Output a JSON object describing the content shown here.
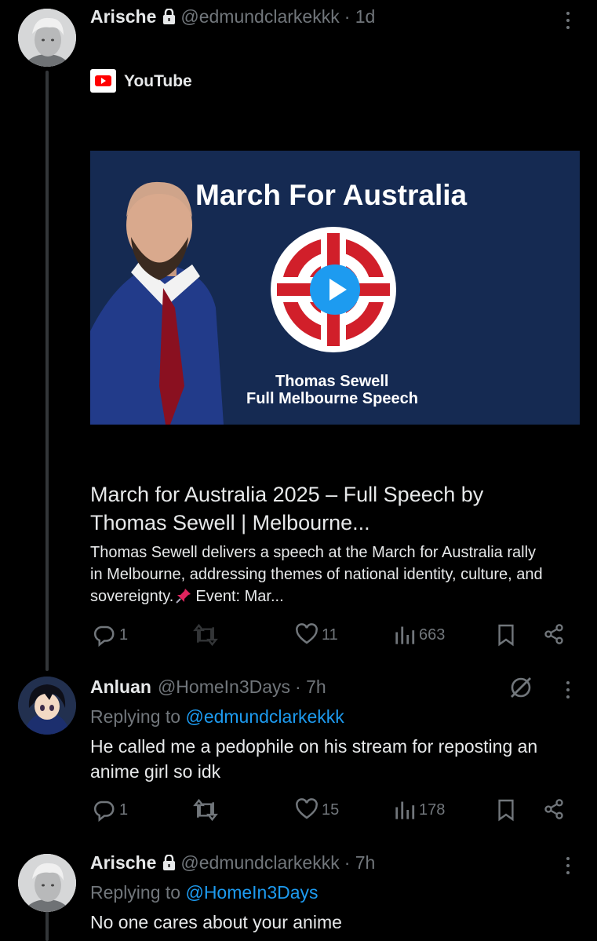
{
  "posts": [
    {
      "author": "Arische",
      "handle": "@edmundclarkekkk",
      "time": "· 1d",
      "link_card": {
        "site": "YouTube",
        "thumbnail": {
          "headline": "March For Australia",
          "caption_line1": "Thomas Sewell",
          "caption_line2": "Full Melbourne Speech"
        },
        "title_line1": "March for Australia 2025 – Full Speech by",
        "title_line2": "Thomas Sewell | Melbourne...",
        "description_line1": "Thomas Sewell delivers a speech at the March for Australia rally",
        "description_line2": "in Melbourne, addressing themes of national identity, culture, and",
        "description_line3": "sovereignty.",
        "description_line3b": "Event: Mar...",
        "pin_icon": "pushpin-icon"
      },
      "stats": {
        "replies": "1",
        "retweets": "",
        "likes": "11",
        "views": "663"
      }
    },
    {
      "author": "Anluan",
      "handle": "@HomeIn3Days",
      "time": "· 7h",
      "replying_label": "Replying to",
      "replying_to": "@edmundclarkekkk",
      "text_line1": "He called me a pedophile on his stream for reposting an",
      "text_line2": "anime girl so idk",
      "stats": {
        "replies": "1",
        "retweets": "",
        "likes": "15",
        "views": "178"
      }
    },
    {
      "author": "Arische",
      "handle": "@edmundclarkekkk",
      "time": "· 7h",
      "replying_label": "Replying to",
      "replying_to": "@HomeIn3Days",
      "text_line1": "No one cares about your anime"
    }
  ],
  "colors": {
    "background": "#000000",
    "text": "#e7e9ea",
    "muted": "#71767b",
    "link": "#1d9bf0",
    "thumb_bg": "#152a52",
    "youtube_red": "#ff0000"
  }
}
